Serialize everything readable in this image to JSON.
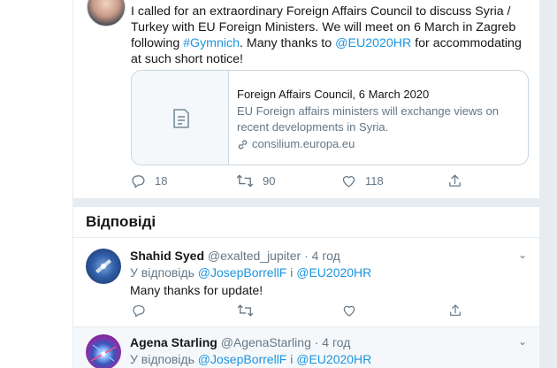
{
  "main_tweet": {
    "text_plain_1": "I called for an extraordinary Foreign Affairs Council to discuss Syria / Turkey with EU Foreign Ministers. We will meet on 6 March in Zagreb following ",
    "hashtag": "#Gymnich",
    "text_plain_2": ". Many thanks to ",
    "mention": "@EU2020HR",
    "text_plain_3": " for accommodating at such short notice!",
    "card": {
      "icon": "document-icon",
      "title": "Foreign Affairs Council, 6 March 2020",
      "description": "EU Foreign affairs ministers will exchange views on recent developments in Syria.",
      "url": "consilium.europa.eu",
      "url_icon": "link-icon"
    },
    "actions": {
      "replies": "18",
      "retweets": "90",
      "likes": "118"
    }
  },
  "replies_header": "Відповіді",
  "replies": [
    {
      "name": "Shahid Syed",
      "handle": "@exalted_jupiter",
      "time": "· 4 год",
      "reply_prefix": "У відповідь ",
      "reply_user1": "@JosepBorrellF",
      "reply_and": " і ",
      "reply_user2": "@EU2020HR",
      "text": "Many thanks for update!"
    },
    {
      "name": "Agena Starling",
      "handle": "@AgenaStarling",
      "time": "· 4 год",
      "reply_prefix": "У відповідь ",
      "reply_user1": "@JosepBorrellF",
      "reply_and": " і ",
      "reply_user2": "@EU2020HR"
    }
  ],
  "colors": {
    "link": "#1b95e0",
    "secondary_text": "#657786",
    "border": "#e6ecf0"
  }
}
